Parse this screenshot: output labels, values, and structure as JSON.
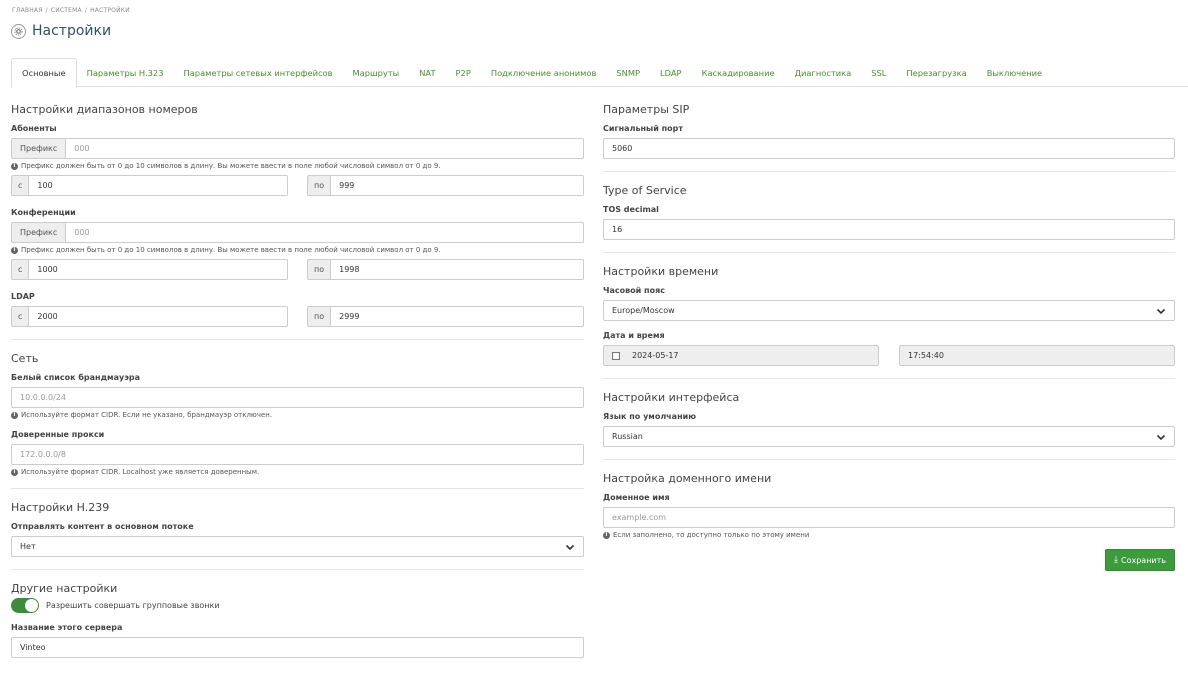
{
  "breadcrumb": [
    "ГЛАВНАЯ",
    "СИСТЕМА",
    "НАСТРОЙКИ"
  ],
  "page_title": "Настройки",
  "tabs": [
    "Основные",
    "Параметры H.323",
    "Параметры сетевых интерфейсов",
    "Маршруты",
    "NAT",
    "P2P",
    "Подключение анонимов",
    "SNMP",
    "LDAP",
    "Каскадирование",
    "Диагностика",
    "SSL",
    "Перезагрузка",
    "Выключение"
  ],
  "left": {
    "ranges_title": "Настройки диапазонов номеров",
    "subscribers": {
      "label": "Абоненты",
      "prefix_addon": "Префикс",
      "prefix_placeholder": "000",
      "help": "Префикс должен быть от 0 до 10 символов в длину. Вы можете ввести в поле любой числовой символ от 0 до 9.",
      "from_addon": "с",
      "from": "100",
      "to_addon": "по",
      "to": "999"
    },
    "conferences": {
      "label": "Конференции",
      "prefix_addon": "Префикс",
      "prefix_placeholder": "000",
      "help": "Префикс должен быть от 0 до 10 символов в длину. Вы можете ввести в поле любой числовой символ от 0 до 9.",
      "from_addon": "с",
      "from": "1000",
      "to_addon": "по",
      "to": "1998"
    },
    "ldap": {
      "label": "LDAP",
      "from_addon": "с",
      "from": "2000",
      "to_addon": "по",
      "to": "2999"
    },
    "network_title": "Сеть",
    "firewall": {
      "label": "Белый список брандмауэра",
      "placeholder": "10.0.0.0/24",
      "help": "Используйте формат CIDR. Если не указано, брандмауэр отключен."
    },
    "proxies": {
      "label": "Доверенные прокси",
      "placeholder": "172.0.0.0/8",
      "help": "Используйте формат CIDR. Localhost уже является доверенным."
    },
    "h239_title": "Настройки H.239",
    "h239": {
      "label": "Отправлять контент в основном потоке",
      "value": "Нет"
    },
    "other_title": "Другие настройки",
    "group_calls": {
      "label": "Разрешить совершать групповые звонки",
      "enabled": true
    },
    "server_name": {
      "label": "Название этого сервера",
      "value": "Vinteo"
    }
  },
  "right": {
    "sip_title": "Параметры SIP",
    "signal_port": {
      "label": "Сигнальный порт",
      "value": "5060"
    },
    "tos_title": "Type of Service",
    "tos": {
      "label": "TOS decimal",
      "value": "16"
    },
    "time_title": "Настройки времени",
    "timezone": {
      "label": "Часовой пояс",
      "value": "Europe/Moscow"
    },
    "datetime": {
      "label": "Дата и время",
      "date": "2024-05-17",
      "time": "17:54:40"
    },
    "iface_title": "Настройки интерфейса",
    "language": {
      "label": "Язык по умолчанию",
      "value": "Russian"
    },
    "domain_title": "Настройка доменного имени",
    "domain": {
      "label": "Доменное имя",
      "placeholder": "example.com",
      "help": "Если заполнено, то доступно только по этому имени"
    },
    "save_label": "Сохранить"
  },
  "colors": {
    "accent": "#3d9b3d",
    "tab_link": "#4d8a2f",
    "title": "#2f4f6f"
  },
  "icons": [
    "settings-icon",
    "info-icon",
    "chevron-down-icon",
    "download-icon"
  ]
}
